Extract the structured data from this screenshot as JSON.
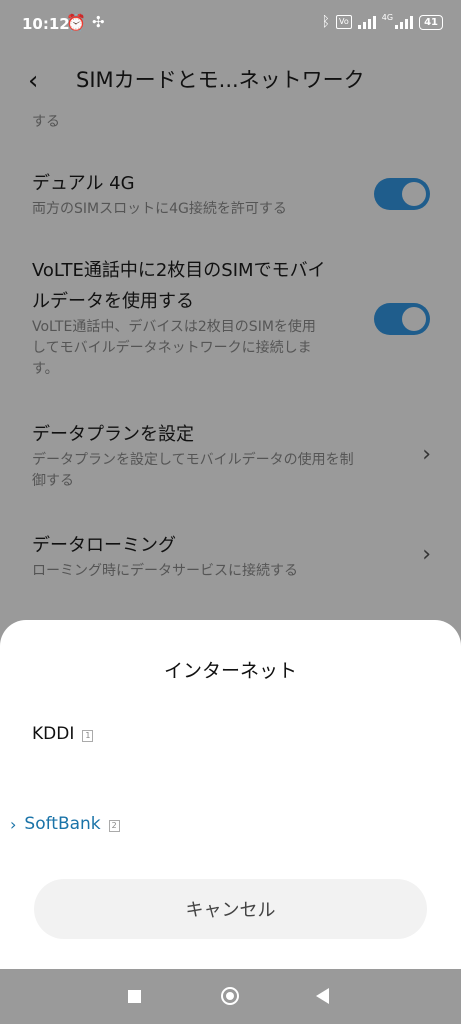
{
  "status_bar": {
    "time": "10:12",
    "vo_label": "Vo",
    "network_label": "4G",
    "battery": "41"
  },
  "header": {
    "back_icon": "‹",
    "title": "SIMカードとモ...ネットワーク"
  },
  "truncated_text": "する",
  "settings": {
    "dual4g": {
      "title": "デュアル 4G",
      "subtitle": "両方のSIMスロットに4G接続を許可する",
      "enabled": true
    },
    "volte": {
      "title_line1": "VoLTE通話中に2枚目のSIMでモバイ",
      "title_line2": "ルデータを使用する",
      "sub_line1": "VoLTE通話中、デバイスは2枚目のSIMを使用",
      "sub_line2": "してモバイルデータネットワークに接続しま",
      "sub_line3": "す。",
      "enabled": true
    },
    "data_plan": {
      "title": "データプランを設定",
      "sub_line1": "データプランを設定してモバイルデータの使用を制",
      "sub_line2": "御する"
    },
    "roaming": {
      "title": "データローミング",
      "subtitle": "ローミング時にデータサービスに接続する"
    }
  },
  "sheet": {
    "title": "インターネット",
    "options": [
      {
        "name": "KDDI",
        "slot": "1",
        "selected": false
      },
      {
        "name": "SoftBank",
        "slot": "2",
        "selected": true
      }
    ],
    "cancel_label": "キャンセル"
  },
  "colors": {
    "accent": "#1a73a8",
    "toggle_on": "#1f5d8c",
    "dim_background": "#9a9a9a"
  }
}
